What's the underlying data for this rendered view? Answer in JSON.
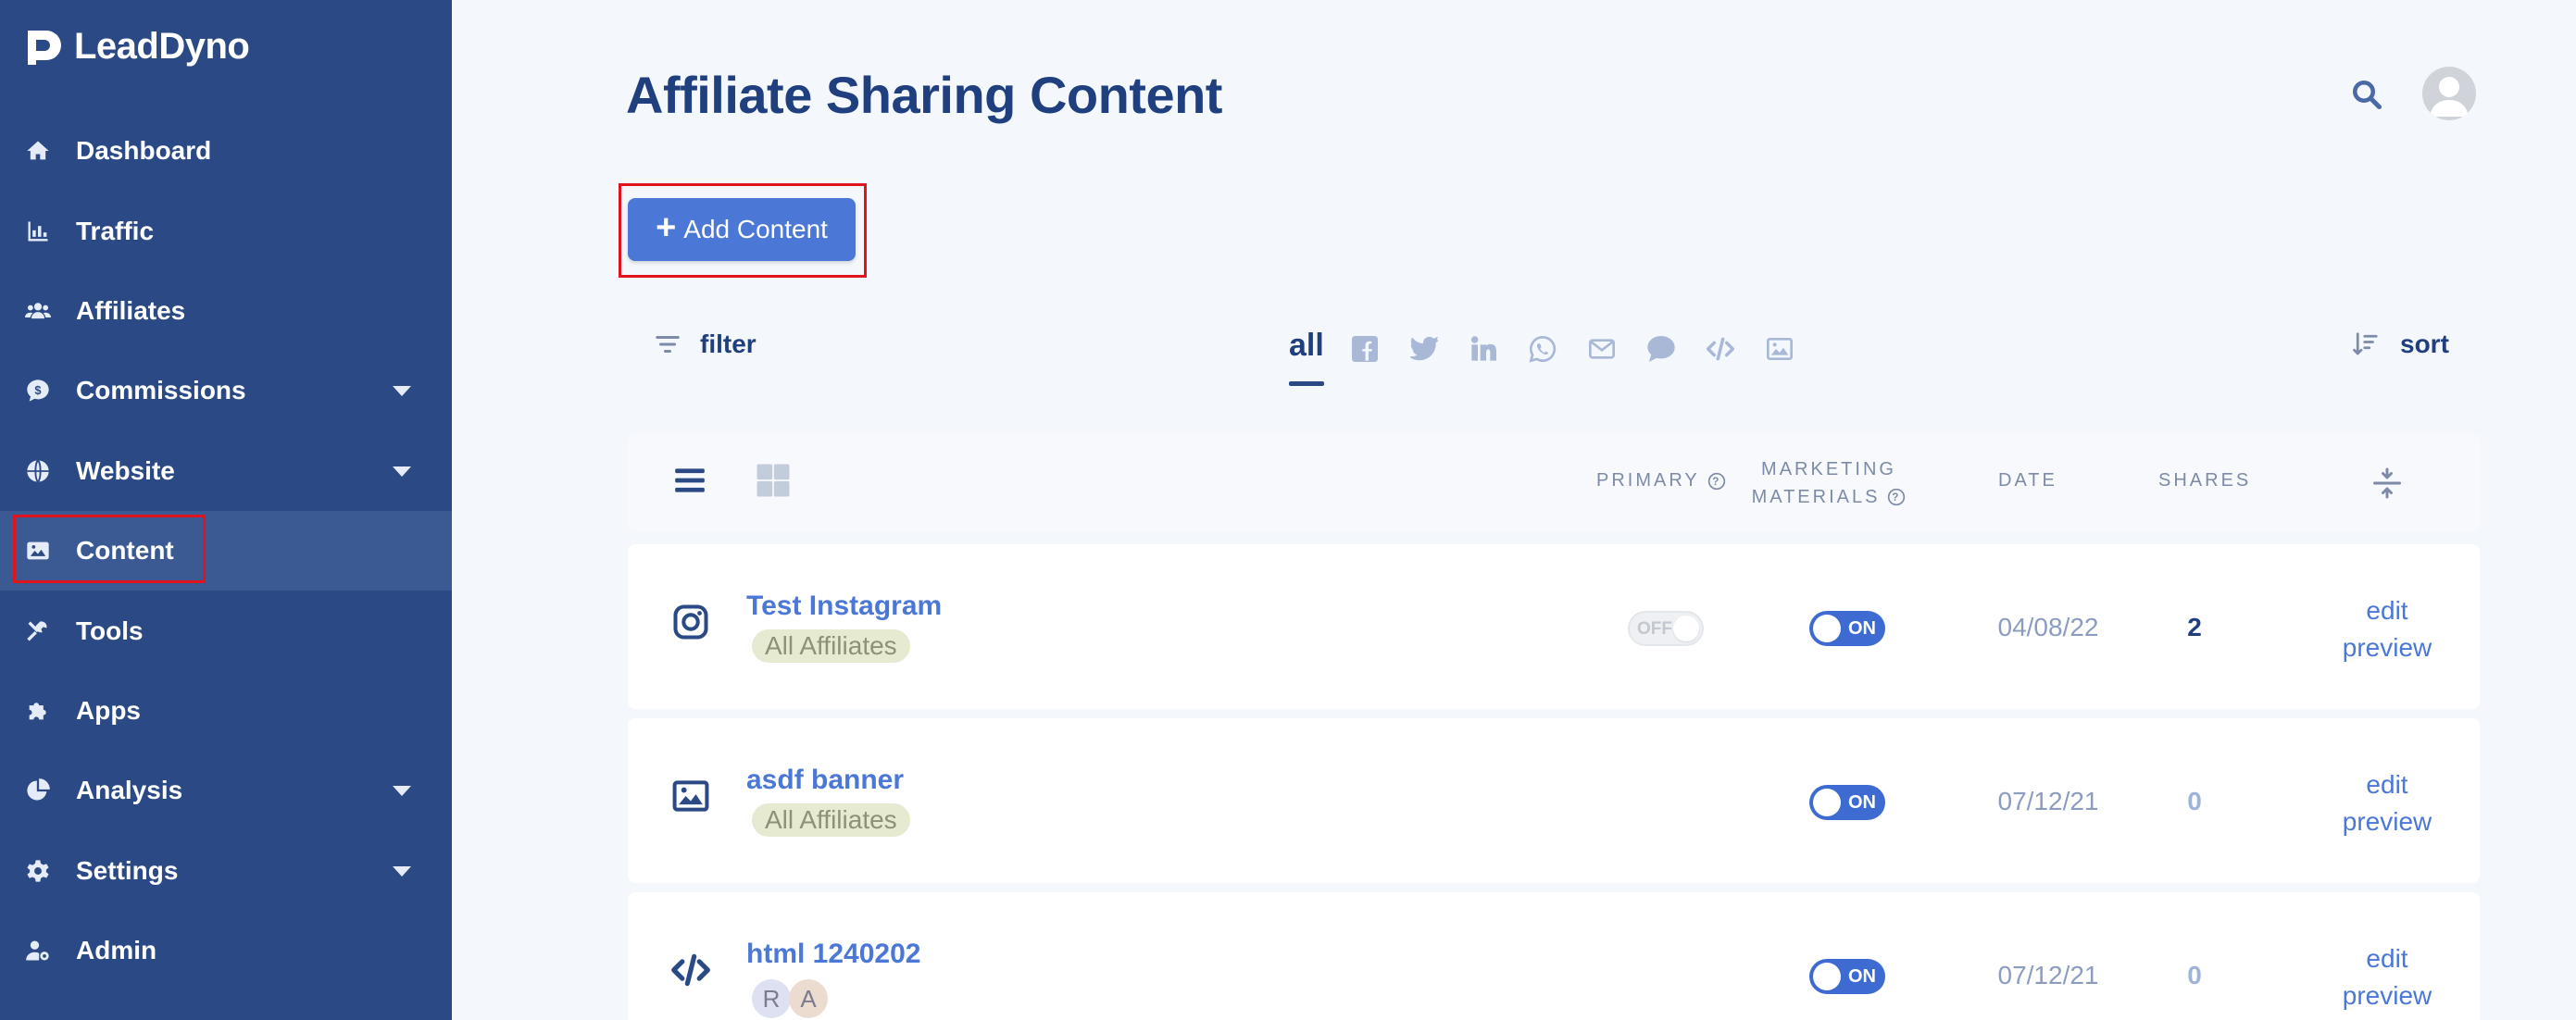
{
  "app": {
    "name": "LeadDyno"
  },
  "sidebar": {
    "items": [
      {
        "label": "Dashboard",
        "icon": "home-icon",
        "has_caret": false
      },
      {
        "label": "Traffic",
        "icon": "bar-chart-icon",
        "has_caret": false
      },
      {
        "label": "Affiliates",
        "icon": "users-icon",
        "has_caret": false
      },
      {
        "label": "Commissions",
        "icon": "dollar-chat-icon",
        "has_caret": true
      },
      {
        "label": "Website",
        "icon": "globe-icon",
        "has_caret": true
      },
      {
        "label": "Content",
        "icon": "image-icon",
        "has_caret": false,
        "active": true
      },
      {
        "label": "Tools",
        "icon": "tools-icon",
        "has_caret": false
      },
      {
        "label": "Apps",
        "icon": "puzzle-icon",
        "has_caret": false
      },
      {
        "label": "Analysis",
        "icon": "pie-chart-icon",
        "has_caret": true
      },
      {
        "label": "Settings",
        "icon": "gear-icon",
        "has_caret": true
      },
      {
        "label": "Admin",
        "icon": "user-cog-icon",
        "has_caret": false
      }
    ]
  },
  "header": {
    "title": "Affiliate Sharing Content"
  },
  "toolbar": {
    "add_label": "Add Content",
    "filter_label": "filter",
    "sort_label": "sort",
    "tab_all": "all",
    "channel_icons": [
      "facebook-icon",
      "twitter-icon",
      "linkedin-icon",
      "whatsapp-icon",
      "email-icon",
      "sms-icon",
      "code-icon",
      "image-icon"
    ]
  },
  "table": {
    "headers": {
      "primary": "PRIMARY",
      "marketing_line1": "MARKETING",
      "marketing_line2": "MATERIALS",
      "date": "DATE",
      "shares": "SHARES"
    },
    "rows": [
      {
        "icon": "instagram-icon",
        "title": "Test Instagram",
        "audience": "All Affiliates",
        "primary": "OFF",
        "marketing": "ON",
        "date": "04/08/22",
        "shares": "2",
        "edit": "edit",
        "preview": "preview"
      },
      {
        "icon": "image-icon",
        "title": "asdf banner",
        "audience": "All Affiliates",
        "marketing": "ON",
        "date": "07/12/21",
        "shares": "0",
        "edit": "edit",
        "preview": "preview"
      },
      {
        "icon": "code-icon",
        "title": "html 1240202",
        "avatars": [
          "R",
          "A"
        ],
        "marketing": "ON",
        "date": "07/12/21",
        "shares": "0",
        "edit": "edit",
        "preview": "preview"
      }
    ]
  },
  "colors": {
    "sidebar": "#2b4a85",
    "accent": "#4b77d6",
    "highlight": "#e0141c"
  }
}
